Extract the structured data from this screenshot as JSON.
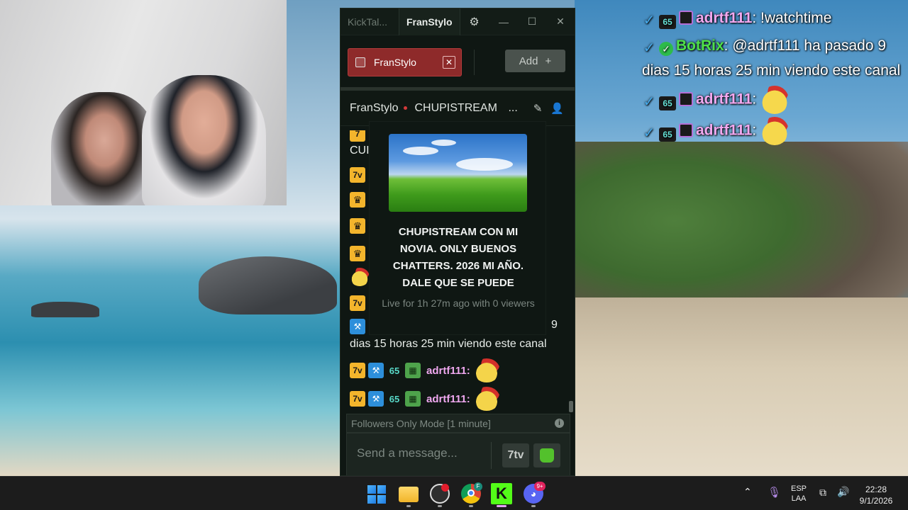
{
  "overlay_chat": [
    {
      "user": "adrtf111",
      "message": ": !watchtime",
      "user_color": "#f2a8ef",
      "badges": [
        "kick-badge-icon",
        "seven-tv-badge-icon",
        "tv-badge-icon"
      ]
    },
    {
      "user": "BotRix",
      "message": ": @adrtf111 ha pasado 9 dias 15 horas 25 min viendo este canal",
      "user_color": "#4fe04a",
      "badges": [
        "kick-badge-icon",
        "verified-badge-icon"
      ]
    },
    {
      "user": "adrtf111",
      "message": ":",
      "user_color": "#f2a8ef",
      "emote": "santa-emote",
      "badges": [
        "kick-badge-icon",
        "seven-tv-badge-icon",
        "tv-badge-icon"
      ]
    },
    {
      "user": "adrtf111",
      "message": ":",
      "user_color": "#f2a8ef",
      "emote": "santa-emote",
      "badges": [
        "kick-badge-icon",
        "seven-tv-badge-icon",
        "tv-badge-icon"
      ]
    }
  ],
  "window": {
    "app_title": "KickTal...",
    "active_tab": "FranStylo",
    "gear_icon": "gear-icon",
    "controls": {
      "minimize": "—",
      "maximize": "☐",
      "close": "✕"
    }
  },
  "channel_tabs": {
    "tab_label": "FranStylo",
    "close": "✕",
    "add_label": "Add",
    "add_icon": "+"
  },
  "channel_header": {
    "name": "FranStylo",
    "stream_title": "CHUPISTREAM",
    "ellipsis": "...",
    "icons": [
      "pin-icon",
      "user-icon"
    ]
  },
  "chat": {
    "partial_top": "CUI",
    "botrix_tail": "9",
    "botrix_line2": "dias 15 horas 25 min viendo este canal",
    "rows": [
      {
        "user": "adrtf111:"
      },
      {
        "user": "adrtf111:"
      }
    ]
  },
  "popover": {
    "title": "CHUPISTREAM CON MI NOVIA. ONLY BUENOS CHATTERS. 2026 MI AÑO. DALE QUE SE PUEDE",
    "subtitle": "Live for 1h 27m ago with 0 viewers"
  },
  "composer": {
    "followers_mode": "Followers Only Mode [1 minute]",
    "info": "i",
    "placeholder": "Send a message...",
    "seven_tv_label": "7tv"
  },
  "taskbar": {
    "discord_badge": "9+",
    "language": "ESP",
    "layout": "LAA",
    "time": "22:28",
    "date": "9/1/2026",
    "apps": [
      "windows-start-icon",
      "file-explorer-icon",
      "obs-icon",
      "chrome-icon",
      "kick-icon",
      "discord-icon"
    ]
  }
}
